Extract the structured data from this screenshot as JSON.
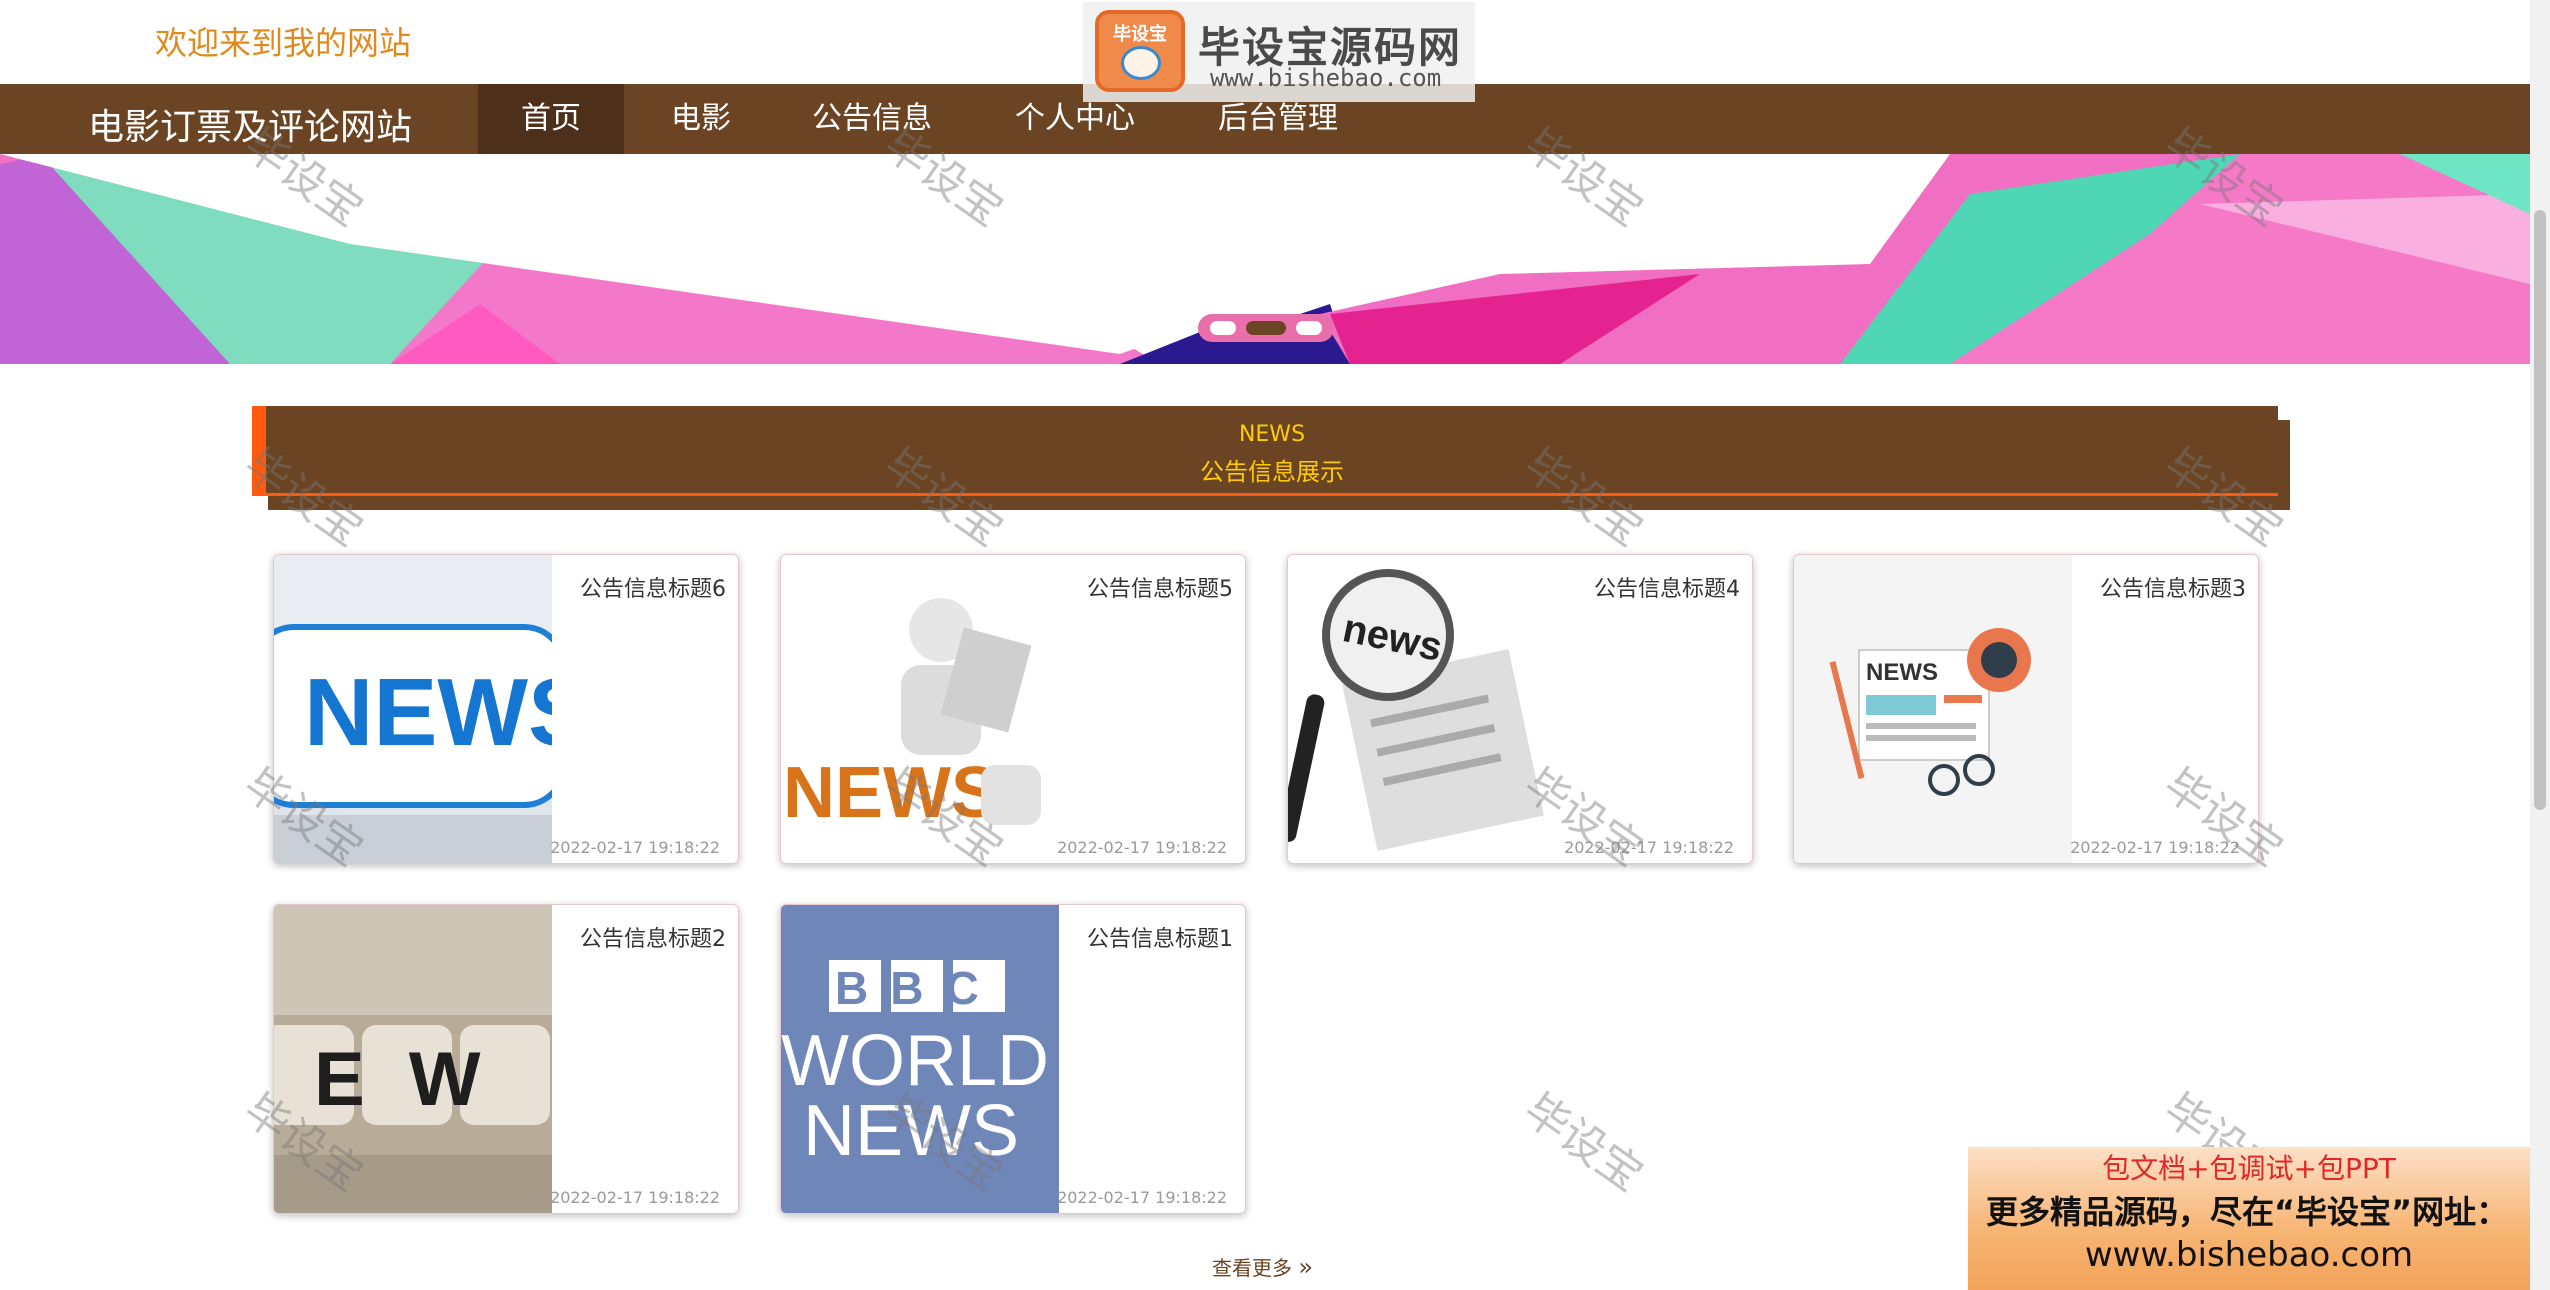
{
  "header": {
    "welcome": "欢迎来到我的网站",
    "logo_title": "毕设宝源码网",
    "logo_url": "www.bishebao.com",
    "logo_badge": "毕设宝"
  },
  "nav": {
    "site_title": "电影订票及评论网站",
    "items": [
      {
        "label": "首页",
        "active": true
      },
      {
        "label": "电影"
      },
      {
        "label": "公告信息"
      },
      {
        "label": "个人中心"
      },
      {
        "label": "后台管理"
      }
    ]
  },
  "banner": {
    "slide_count": 3,
    "active_slide": 2
  },
  "news_section": {
    "en_title": "NEWS",
    "cn_title": "公告信息展示"
  },
  "news": [
    {
      "title": "公告信息标题6",
      "time": "2022-02-17 19:18:22",
      "image_text": "NEWS"
    },
    {
      "title": "公告信息标题5",
      "time": "2022-02-17 19:18:22",
      "image_text": "NEWS"
    },
    {
      "title": "公告信息标题4",
      "time": "2022-02-17 19:18:22",
      "image_text": "news"
    },
    {
      "title": "公告信息标题3",
      "time": "2022-02-17 19:18:22",
      "image_text": "NEWS"
    },
    {
      "title": "公告信息标题2",
      "time": "2022-02-17 19:18:22",
      "image_text": "EW"
    },
    {
      "title": "公告信息标题1",
      "time": "2022-02-17 19:18:22",
      "image_text_1": "BBC",
      "image_text_2": "WORLD",
      "image_text_3": "NEWS"
    }
  ],
  "more_label": "查看更多",
  "watermark": "毕设宝",
  "ad": {
    "line1": "包文档+包调试+包PPT",
    "line2": "更多精品源码，尽在“毕设宝”网址：",
    "line3": "www.bishebao.com"
  },
  "colors": {
    "nav_bg": "#6b4423",
    "accent": "#ff5a0d",
    "news_text": "#ffcc00",
    "welcome": "#e08a1e"
  }
}
